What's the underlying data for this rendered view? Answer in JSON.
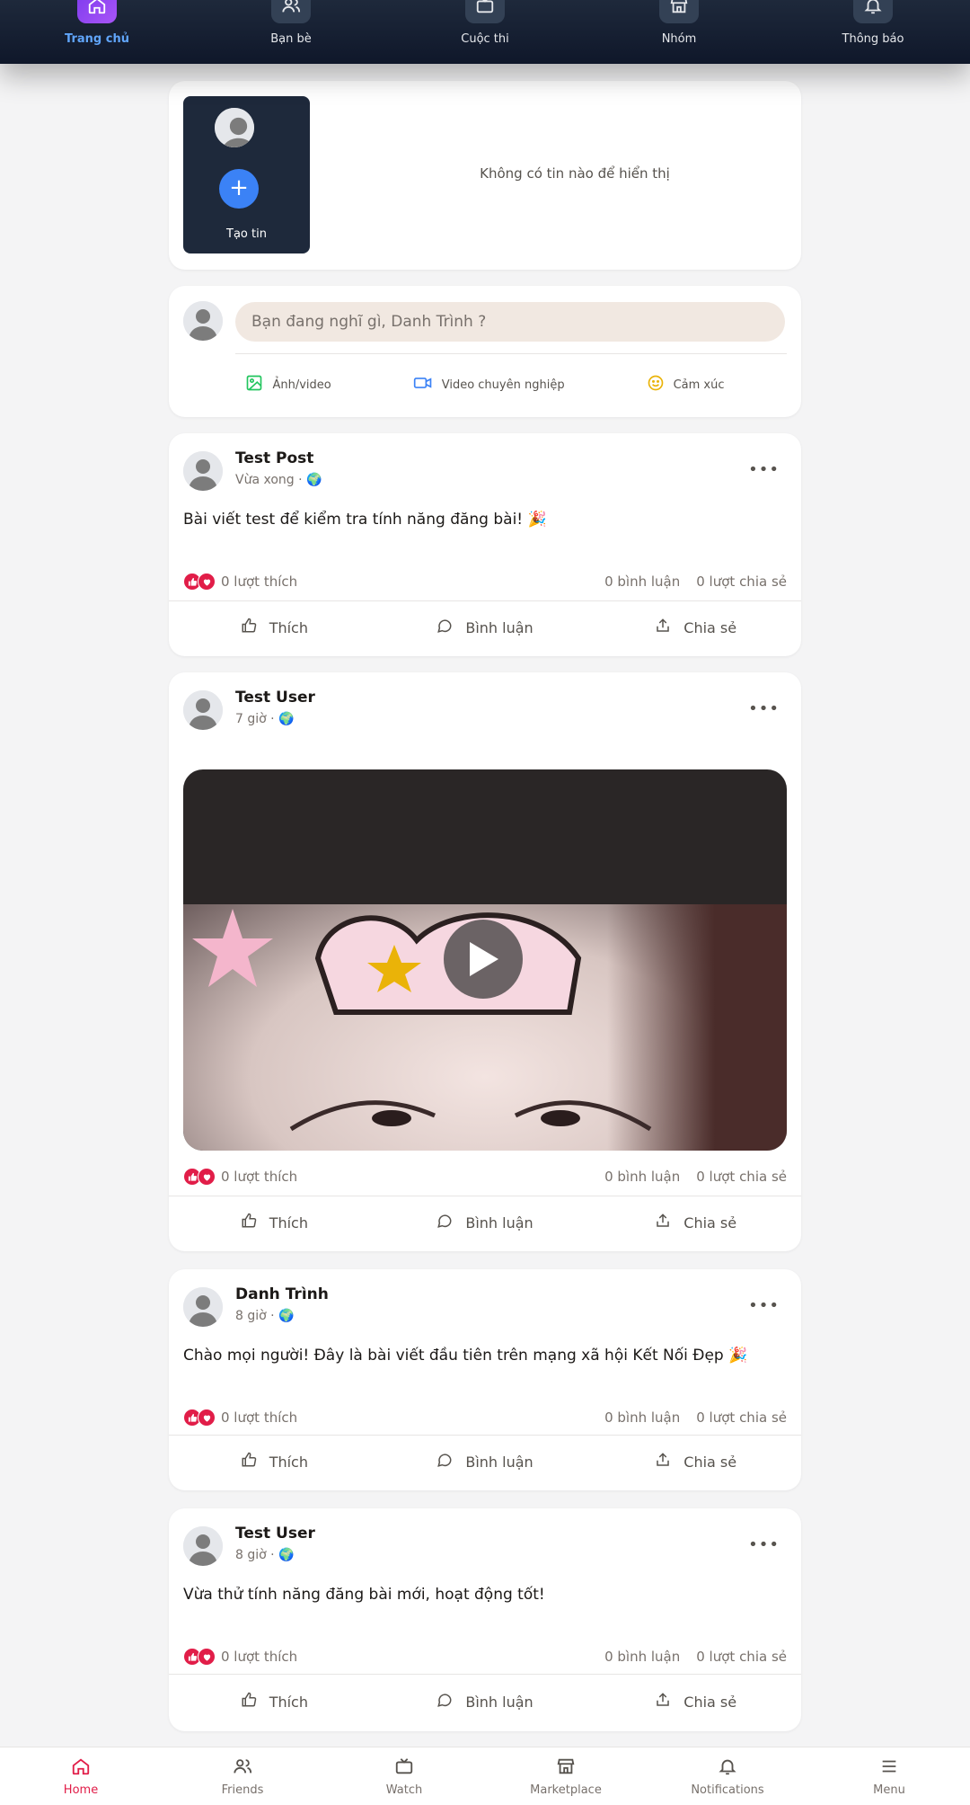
{
  "top_nav": {
    "items": [
      {
        "label": "Trang chủ",
        "icon": "home-icon",
        "active": true
      },
      {
        "label": "Bạn bè",
        "icon": "friends-icon"
      },
      {
        "label": "Cuộc thi",
        "icon": "tv-icon"
      },
      {
        "label": "Nhóm",
        "icon": "store-icon"
      },
      {
        "label": "Thông báo",
        "icon": "bell-icon"
      }
    ]
  },
  "stories": {
    "create_label": "Tạo tin",
    "empty_text": "Không có tin nào để hiển thị"
  },
  "composer": {
    "placeholder": "Bạn đang nghĩ gì, Danh Trình ?",
    "actions": [
      {
        "label": "Ảnh/video",
        "icon": "image-icon",
        "color": "#22c55e"
      },
      {
        "label": "Video chuyên nghiệp",
        "icon": "video-camera-icon",
        "color": "#3b82f6"
      },
      {
        "label": "Cảm xúc",
        "icon": "smiley-icon",
        "color": "#eab308"
      }
    ]
  },
  "posts": [
    {
      "author": "Test Post",
      "meta": "Vừa xong · 🌍",
      "text": "Bài viết test để kiểm tra tính năng đăng bài! 🎉",
      "likes": "0 lượt thích",
      "comments": "0 bình luận",
      "shares": "0 lượt chia sẻ"
    },
    {
      "author": "Test User",
      "meta": "7 giờ · 🌍",
      "text": "",
      "likes": "0 lượt thích",
      "comments": "0 bình luận",
      "shares": "0 lượt chia sẻ",
      "has_video": true
    },
    {
      "author": "Danh Trình",
      "meta": "8 giờ · 🌍",
      "text": "Chào mọi người! Đây là bài viết đầu tiên trên mạng xã hội Kết Nối Đẹp 🎉",
      "likes": "0 lượt thích",
      "comments": "0 bình luận",
      "shares": "0 lượt chia sẻ"
    },
    {
      "author": "Test User",
      "meta": "8 giờ · 🌍",
      "text": "Vừa thử tính năng đăng bài mới, hoạt động tốt!",
      "likes": "0 lượt thích",
      "comments": "0 bình luận",
      "shares": "0 lượt chia sẻ"
    }
  ],
  "post_actions": {
    "like": "Thích",
    "comment": "Bình luận",
    "share": "Chia sẻ"
  },
  "bottom_nav": {
    "items": [
      {
        "label": "Home",
        "icon": "home-icon",
        "active": true
      },
      {
        "label": "Friends",
        "icon": "friends-icon"
      },
      {
        "label": "Watch",
        "icon": "tv-icon"
      },
      {
        "label": "Marketplace",
        "icon": "store-icon"
      },
      {
        "label": "Notifications",
        "icon": "bell-icon"
      },
      {
        "label": "Menu",
        "icon": "menu-icon"
      }
    ]
  },
  "colors": {
    "accent": "#e11d48",
    "top_nav_active": "#60a5fa",
    "story_bg": "#1e293b",
    "primary_blue": "#3b82f6"
  }
}
